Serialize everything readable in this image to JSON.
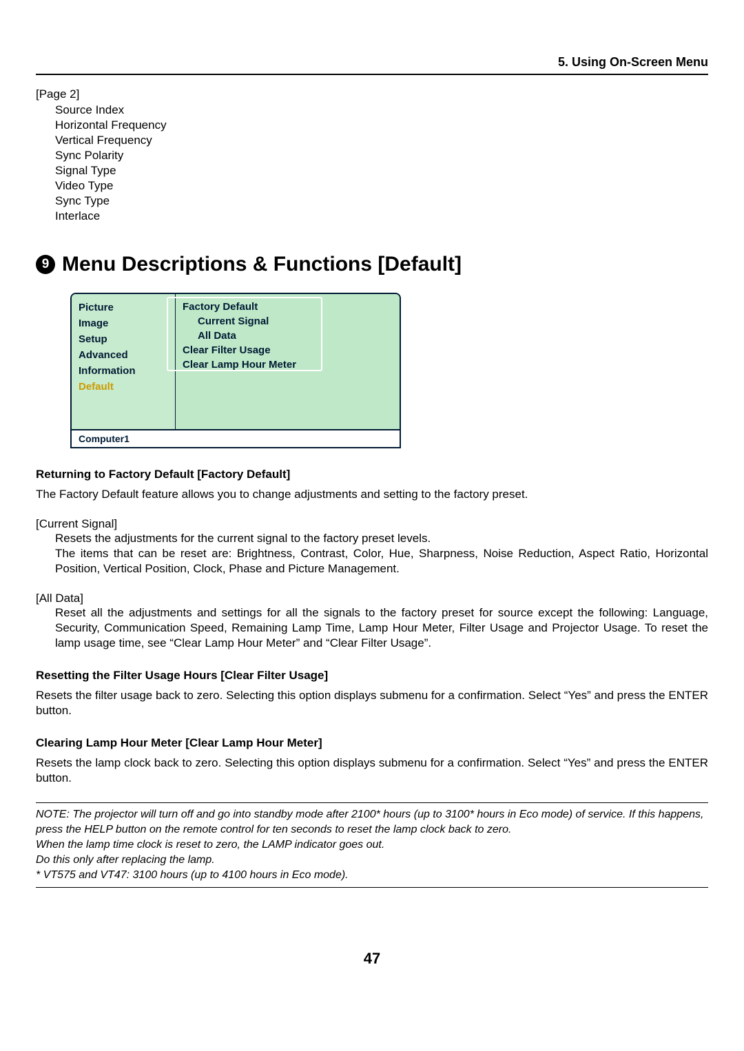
{
  "header": "5. Using On-Screen Menu",
  "page2": {
    "label": "[Page 2]",
    "items": [
      "Source Index",
      "Horizontal Frequency",
      "Vertical Frequency",
      "Sync Polarity",
      "Signal Type",
      "Video Type",
      "Sync Type",
      "Interlace"
    ]
  },
  "heading": {
    "num": "9",
    "text": "Menu Descriptions & Functions [Default]"
  },
  "osd": {
    "left": [
      "Picture",
      "Image",
      "Setup",
      "Advanced",
      "Information",
      "Default"
    ],
    "selectedIndex": 5,
    "right": {
      "fd": "Factory Default",
      "cs": "Current Signal",
      "ad": "All Data",
      "cfu": "Clear Filter Usage",
      "clh": "Clear Lamp Hour Meter"
    },
    "status": "Computer1"
  },
  "sections": {
    "fd": {
      "title": "Returning to Factory Default [Factory Default]",
      "intro": "The Factory Default feature allows you to change adjustments and setting to the factory preset.",
      "cs_label": "[Current Signal]",
      "cs_l1": "Resets the adjustments for the current signal to the factory preset levels.",
      "cs_l2": "The items that can be reset are: Brightness, Contrast, Color, Hue, Sharpness, Noise Reduction, Aspect Ratio, Horizontal Position, Vertical Position, Clock, Phase and Picture Management.",
      "ad_label": "[All Data]",
      "ad_l1": "Reset all the adjustments and settings for all the signals to the factory preset for source except the following: Language, Security, Communication Speed, Remaining Lamp Time, Lamp Hour Meter, Filter Usage and Projector Usage. To reset the lamp usage time, see “Clear Lamp Hour Meter” and “Clear Filter Usage”."
    },
    "cfu": {
      "title": "Resetting the Filter Usage Hours [Clear Filter Usage]",
      "body": "Resets the filter usage back to zero. Selecting this option displays submenu for a confirmation. Select “Yes” and press the ENTER button."
    },
    "clh": {
      "title": "Clearing Lamp Hour Meter [Clear Lamp Hour Meter]",
      "body": "Resets the lamp clock back to zero. Selecting this option displays submenu for a confirmation. Select “Yes” and press the ENTER button."
    }
  },
  "note": {
    "l1": "NOTE: The projector will turn off and go into standby mode after 2100* hours (up to 3100* hours in Eco mode) of service. If this happens, press the HELP button on the remote control for ten seconds to reset the lamp clock back to zero.",
    "l2": "When the lamp time clock is reset to zero, the LAMP indicator goes out.",
    "l3": "Do this only after replacing the lamp.",
    "l4": "* VT575 and VT47: 3100 hours (up to 4100 hours in Eco mode)."
  },
  "pageNumber": "47"
}
